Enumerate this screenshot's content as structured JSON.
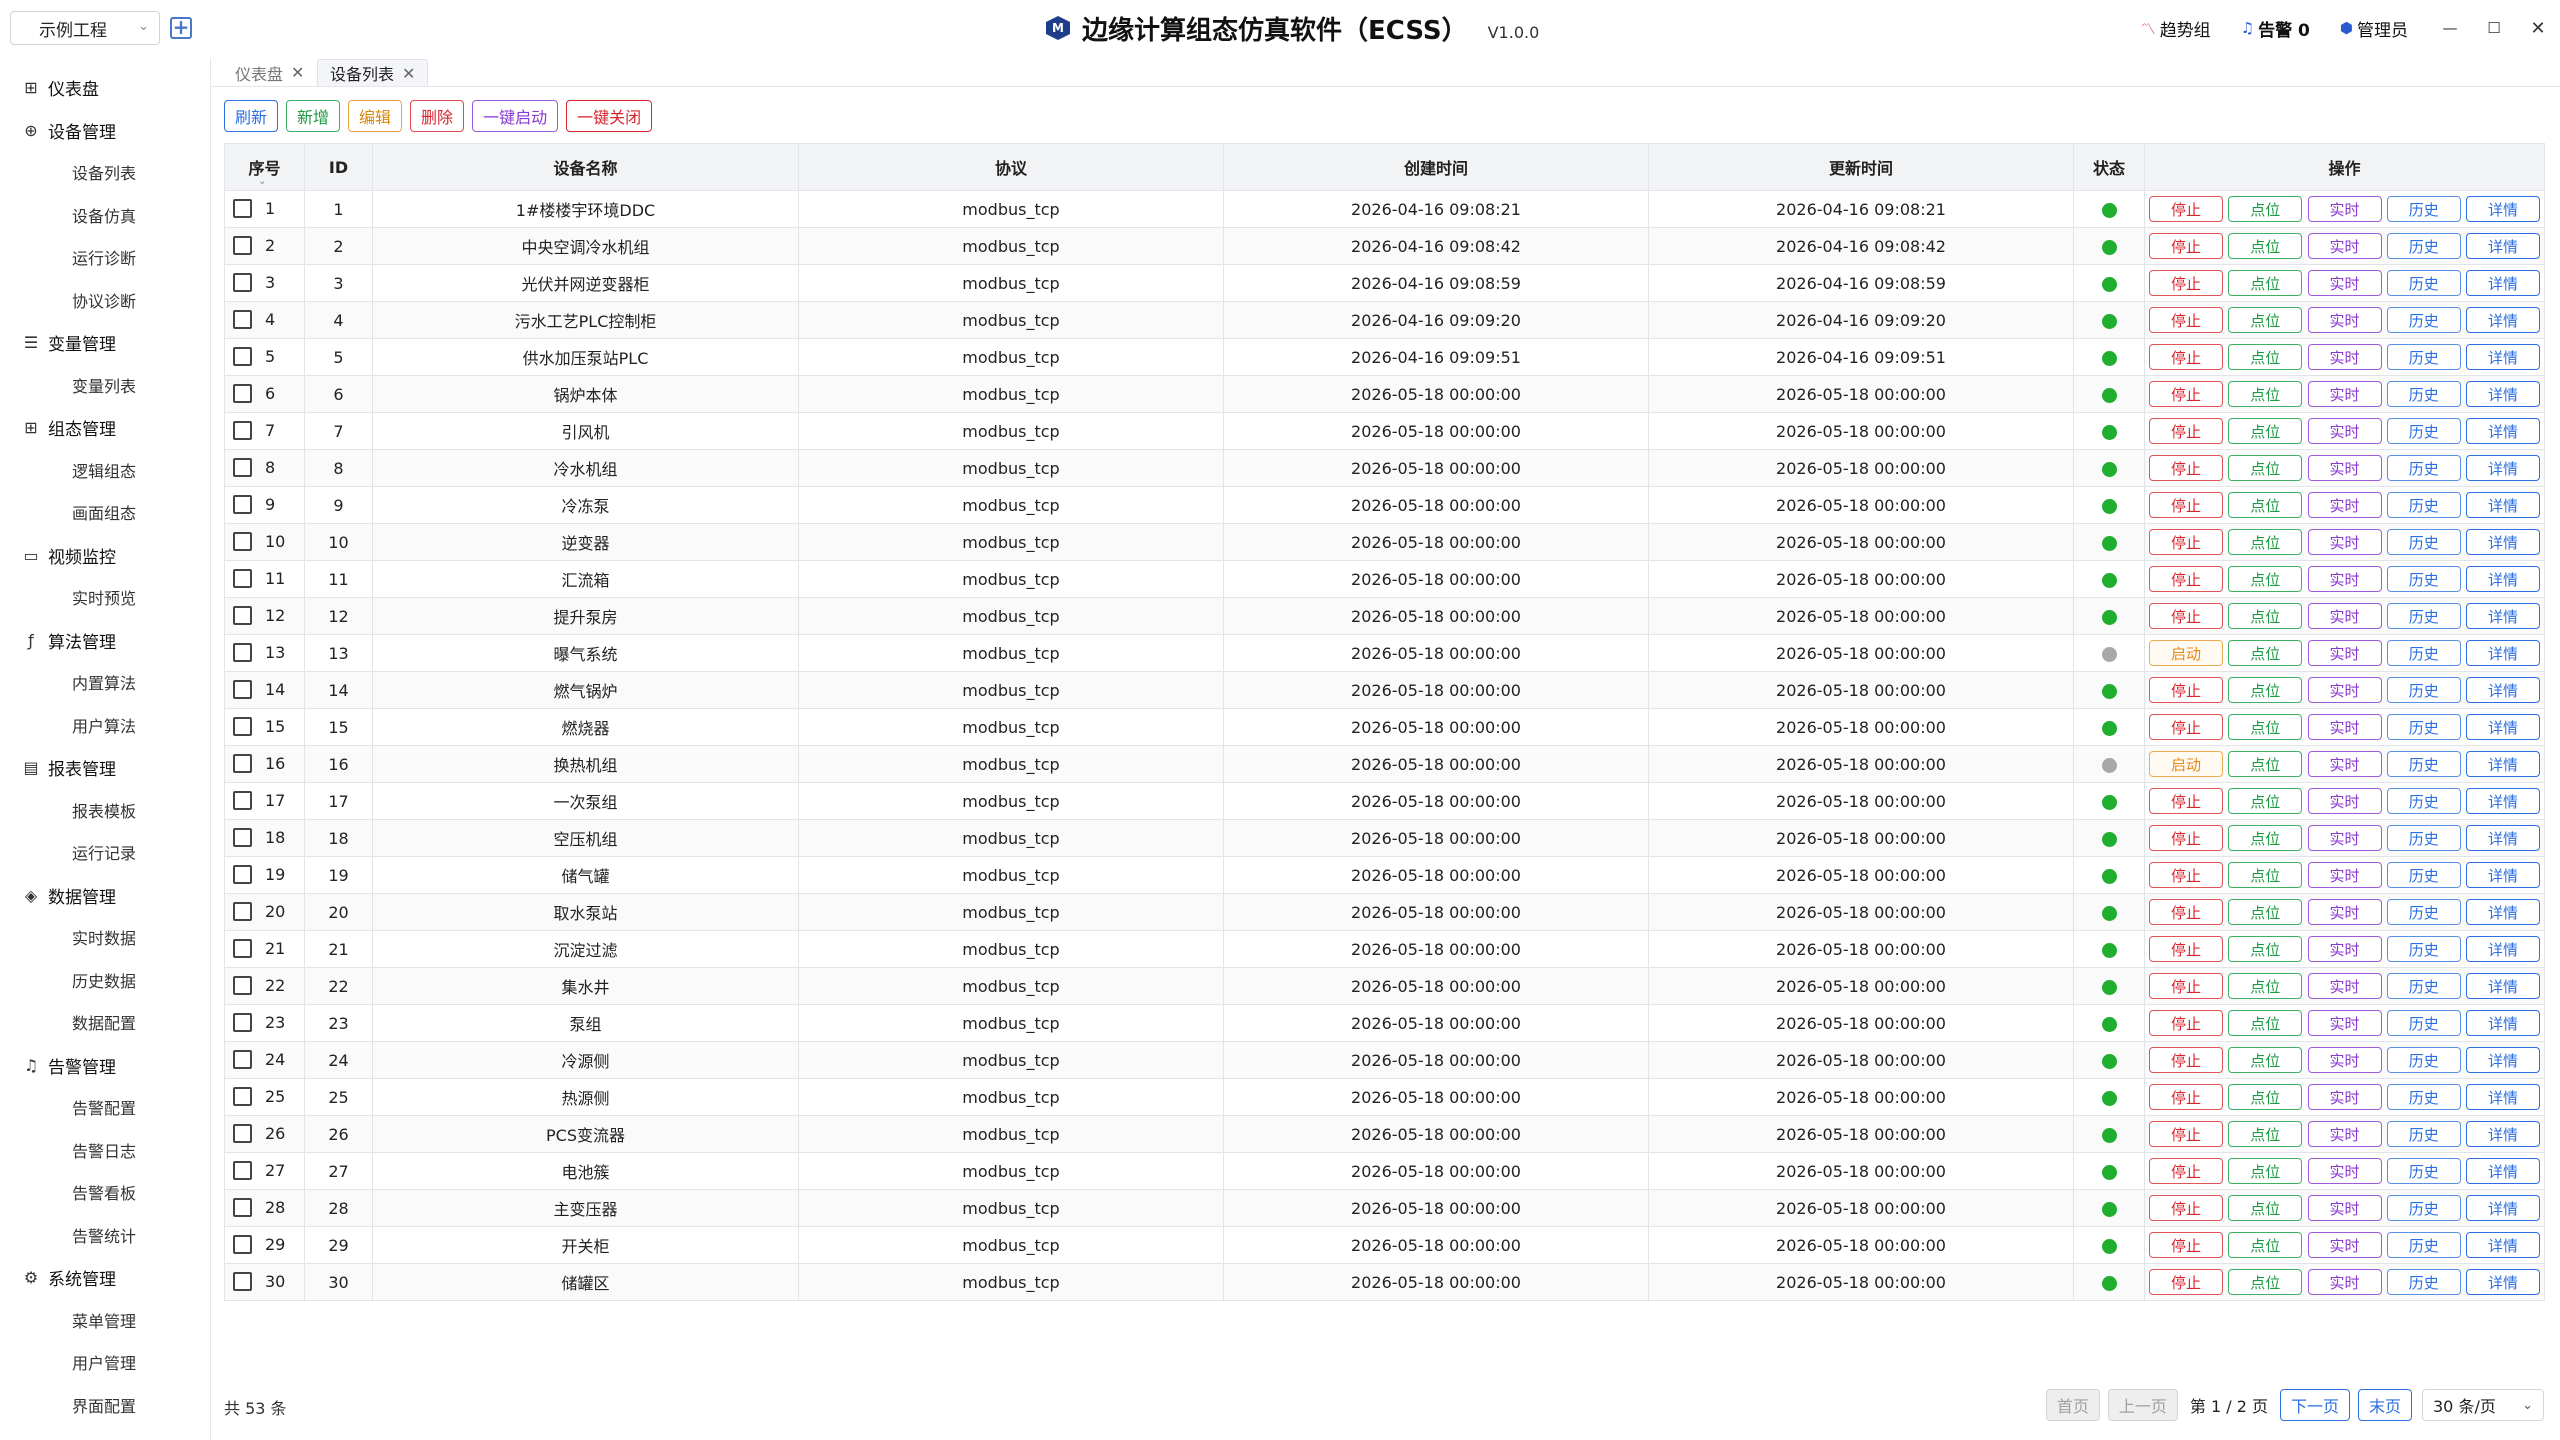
{
  "header": {
    "project": "示例工程",
    "title": "边缘计算组态仿真软件（ECSS）",
    "version": "V1.0.0",
    "trend": "趋势组",
    "alarm": "告警 0",
    "user": "管理员",
    "icons": [
      "chevron-down-icon",
      "add-project-icon",
      "app-logo-icon",
      "trend-icon",
      "bell-icon",
      "user-icon",
      "minimize-icon",
      "maximize-icon",
      "close-icon"
    ]
  },
  "sidebar": {
    "groups": [
      {
        "label": "仪表盘",
        "icon": "dashboard-icon",
        "items": []
      },
      {
        "label": "设备管理",
        "icon": "device-icon",
        "items": [
          "设备列表",
          "设备仿真",
          "运行诊断",
          "协议诊断"
        ]
      },
      {
        "label": "变量管理",
        "icon": "database-icon",
        "items": [
          "变量列表"
        ]
      },
      {
        "label": "组态管理",
        "icon": "grid-icon",
        "items": [
          "逻辑组态",
          "画面组态"
        ]
      },
      {
        "label": "视频监控",
        "icon": "folder-icon",
        "items": [
          "实时预览"
        ]
      },
      {
        "label": "算法管理",
        "icon": "function-icon",
        "items": [
          "内置算法",
          "用户算法"
        ]
      },
      {
        "label": "报表管理",
        "icon": "report-icon",
        "items": [
          "报表模板",
          "运行记录"
        ]
      },
      {
        "label": "数据管理",
        "icon": "layers-icon",
        "items": [
          "实时数据",
          "历史数据",
          "数据配置"
        ]
      },
      {
        "label": "告警管理",
        "icon": "bell-icon",
        "items": [
          "告警配置",
          "告警日志",
          "告警看板",
          "告警统计"
        ]
      },
      {
        "label": "系统管理",
        "icon": "settings-icon",
        "items": [
          "菜单管理",
          "用户管理",
          "界面配置"
        ]
      }
    ]
  },
  "tabs": [
    {
      "label": "仪表盘",
      "active": false
    },
    {
      "label": "设备列表",
      "active": true
    }
  ],
  "toolbar": {
    "refresh": "刷新",
    "add": "新增",
    "edit": "编辑",
    "delete": "删除",
    "start_all": "一键启动",
    "stop_all": "一键关闭"
  },
  "table": {
    "columns": [
      "序号",
      "ID",
      "设备名称",
      "协议",
      "创建时间",
      "更新时间",
      "状态",
      "操作"
    ],
    "op_labels": {
      "stop": "停止",
      "start": "启动",
      "point": "点位",
      "realtime": "实时",
      "history": "历史",
      "detail": "详情"
    },
    "status_colors": {
      "running": "#1fae2e",
      "stopped": "#a8a8a8"
    },
    "rows": [
      {
        "seq": "1",
        "id": "1",
        "name": "1#楼楼宇环境DDC",
        "protocol": "modbus_tcp",
        "created": "2026-04-16 09:08:21",
        "updated": "2026-04-16 09:08:21",
        "status": "running"
      },
      {
        "seq": "2",
        "id": "2",
        "name": "中央空调冷水机组",
        "protocol": "modbus_tcp",
        "created": "2026-04-16 09:08:42",
        "updated": "2026-04-16 09:08:42",
        "status": "running"
      },
      {
        "seq": "3",
        "id": "3",
        "name": "光伏并网逆变器柜",
        "protocol": "modbus_tcp",
        "created": "2026-04-16 09:08:59",
        "updated": "2026-04-16 09:08:59",
        "status": "running"
      },
      {
        "seq": "4",
        "id": "4",
        "name": "污水工艺PLC控制柜",
        "protocol": "modbus_tcp",
        "created": "2026-04-16 09:09:20",
        "updated": "2026-04-16 09:09:20",
        "status": "running"
      },
      {
        "seq": "5",
        "id": "5",
        "name": "供水加压泵站PLC",
        "protocol": "modbus_tcp",
        "created": "2026-04-16 09:09:51",
        "updated": "2026-04-16 09:09:51",
        "status": "running"
      },
      {
        "seq": "6",
        "id": "6",
        "name": "锅炉本体",
        "protocol": "modbus_tcp",
        "created": "2026-05-18 00:00:00",
        "updated": "2026-05-18 00:00:00",
        "status": "running"
      },
      {
        "seq": "7",
        "id": "7",
        "name": "引风机",
        "protocol": "modbus_tcp",
        "created": "2026-05-18 00:00:00",
        "updated": "2026-05-18 00:00:00",
        "status": "running"
      },
      {
        "seq": "8",
        "id": "8",
        "name": "冷水机组",
        "protocol": "modbus_tcp",
        "created": "2026-05-18 00:00:00",
        "updated": "2026-05-18 00:00:00",
        "status": "running"
      },
      {
        "seq": "9",
        "id": "9",
        "name": "冷冻泵",
        "protocol": "modbus_tcp",
        "created": "2026-05-18 00:00:00",
        "updated": "2026-05-18 00:00:00",
        "status": "running"
      },
      {
        "seq": "10",
        "id": "10",
        "name": "逆变器",
        "protocol": "modbus_tcp",
        "created": "2026-05-18 00:00:00",
        "updated": "2026-05-18 00:00:00",
        "status": "running"
      },
      {
        "seq": "11",
        "id": "11",
        "name": "汇流箱",
        "protocol": "modbus_tcp",
        "created": "2026-05-18 00:00:00",
        "updated": "2026-05-18 00:00:00",
        "status": "running"
      },
      {
        "seq": "12",
        "id": "12",
        "name": "提升泵房",
        "protocol": "modbus_tcp",
        "created": "2026-05-18 00:00:00",
        "updated": "2026-05-18 00:00:00",
        "status": "running"
      },
      {
        "seq": "13",
        "id": "13",
        "name": "曝气系统",
        "protocol": "modbus_tcp",
        "created": "2026-05-18 00:00:00",
        "updated": "2026-05-18 00:00:00",
        "status": "stopped"
      },
      {
        "seq": "14",
        "id": "14",
        "name": "燃气锅炉",
        "protocol": "modbus_tcp",
        "created": "2026-05-18 00:00:00",
        "updated": "2026-05-18 00:00:00",
        "status": "running"
      },
      {
        "seq": "15",
        "id": "15",
        "name": "燃烧器",
        "protocol": "modbus_tcp",
        "created": "2026-05-18 00:00:00",
        "updated": "2026-05-18 00:00:00",
        "status": "running"
      },
      {
        "seq": "16",
        "id": "16",
        "name": "换热机组",
        "protocol": "modbus_tcp",
        "created": "2026-05-18 00:00:00",
        "updated": "2026-05-18 00:00:00",
        "status": "stopped"
      },
      {
        "seq": "17",
        "id": "17",
        "name": "一次泵组",
        "protocol": "modbus_tcp",
        "created": "2026-05-18 00:00:00",
        "updated": "2026-05-18 00:00:00",
        "status": "running"
      },
      {
        "seq": "18",
        "id": "18",
        "name": "空压机组",
        "protocol": "modbus_tcp",
        "created": "2026-05-18 00:00:00",
        "updated": "2026-05-18 00:00:00",
        "status": "running"
      },
      {
        "seq": "19",
        "id": "19",
        "name": "储气罐",
        "protocol": "modbus_tcp",
        "created": "2026-05-18 00:00:00",
        "updated": "2026-05-18 00:00:00",
        "status": "running"
      },
      {
        "seq": "20",
        "id": "20",
        "name": "取水泵站",
        "protocol": "modbus_tcp",
        "created": "2026-05-18 00:00:00",
        "updated": "2026-05-18 00:00:00",
        "status": "running"
      },
      {
        "seq": "21",
        "id": "21",
        "name": "沉淀过滤",
        "protocol": "modbus_tcp",
        "created": "2026-05-18 00:00:00",
        "updated": "2026-05-18 00:00:00",
        "status": "running"
      },
      {
        "seq": "22",
        "id": "22",
        "name": "集水井",
        "protocol": "modbus_tcp",
        "created": "2026-05-18 00:00:00",
        "updated": "2026-05-18 00:00:00",
        "status": "running"
      },
      {
        "seq": "23",
        "id": "23",
        "name": "泵组",
        "protocol": "modbus_tcp",
        "created": "2026-05-18 00:00:00",
        "updated": "2026-05-18 00:00:00",
        "status": "running"
      },
      {
        "seq": "24",
        "id": "24",
        "name": "冷源侧",
        "protocol": "modbus_tcp",
        "created": "2026-05-18 00:00:00",
        "updated": "2026-05-18 00:00:00",
        "status": "running"
      },
      {
        "seq": "25",
        "id": "25",
        "name": "热源侧",
        "protocol": "modbus_tcp",
        "created": "2026-05-18 00:00:00",
        "updated": "2026-05-18 00:00:00",
        "status": "running"
      },
      {
        "seq": "26",
        "id": "26",
        "name": "PCS变流器",
        "protocol": "modbus_tcp",
        "created": "2026-05-18 00:00:00",
        "updated": "2026-05-18 00:00:00",
        "status": "running"
      },
      {
        "seq": "27",
        "id": "27",
        "name": "电池簇",
        "protocol": "modbus_tcp",
        "created": "2026-05-18 00:00:00",
        "updated": "2026-05-18 00:00:00",
        "status": "running"
      },
      {
        "seq": "28",
        "id": "28",
        "name": "主变压器",
        "protocol": "modbus_tcp",
        "created": "2026-05-18 00:00:00",
        "updated": "2026-05-18 00:00:00",
        "status": "running"
      },
      {
        "seq": "29",
        "id": "29",
        "name": "开关柜",
        "protocol": "modbus_tcp",
        "created": "2026-05-18 00:00:00",
        "updated": "2026-05-18 00:00:00",
        "status": "running"
      },
      {
        "seq": "30",
        "id": "30",
        "name": "储罐区",
        "protocol": "modbus_tcp",
        "created": "2026-05-18 00:00:00",
        "updated": "2026-05-18 00:00:00",
        "status": "running"
      }
    ]
  },
  "footer": {
    "total": "共 53 条",
    "first": "首页",
    "prev": "上一页",
    "page_info": "第 1 / 2 页",
    "next": "下一页",
    "last": "末页",
    "page_size": "30 条/页"
  }
}
